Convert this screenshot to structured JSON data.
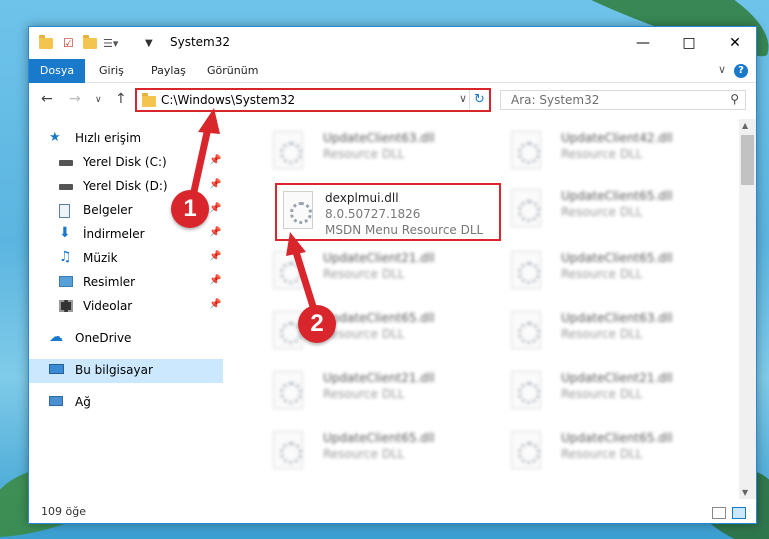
{
  "window": {
    "title": "System32",
    "accent": "#1979ca",
    "highlight": "#d9262c"
  },
  "ribbon": {
    "tabs": [
      "Dosya",
      "Giriş",
      "Paylaş",
      "Görünüm"
    ],
    "help_label": "?"
  },
  "nav": {
    "address": "C:\\Windows\\System32",
    "search_placeholder": "Ara: System32"
  },
  "sidebar": {
    "items": [
      {
        "label": "Hızlı erişim",
        "icon": "star-icon"
      },
      {
        "label": "Yerel Disk (C:)",
        "icon": "drive-icon"
      },
      {
        "label": "Yerel Disk (D:)",
        "icon": "drive-icon"
      },
      {
        "label": "Belgeler",
        "icon": "documents-icon"
      },
      {
        "label": "İndirmeler",
        "icon": "download-icon"
      },
      {
        "label": "Müzik",
        "icon": "music-icon"
      },
      {
        "label": "Resimler",
        "icon": "pictures-icon"
      },
      {
        "label": "Videolar",
        "icon": "videos-icon"
      },
      {
        "label": "OneDrive",
        "icon": "cloud-icon"
      },
      {
        "label": "Bu bilgisayar",
        "icon": "computer-icon"
      },
      {
        "label": "Ağ",
        "icon": "network-icon"
      }
    ]
  },
  "files": [
    {
      "name": "UpdateClient63.dll",
      "desc": "Resource DLL"
    },
    {
      "name": "UpdateClient42.dll",
      "desc": "Resource DLL"
    },
    {
      "name": "UpdateClient65.dll",
      "desc": "Resource DLL"
    },
    {
      "name": "UpdateClient21.dll",
      "desc": "Resource DLL"
    },
    {
      "name": "UpdateClient65.dll",
      "desc": "Resource DLL"
    },
    {
      "name": "UpdateClient65.dll",
      "desc": "Resource DLL"
    },
    {
      "name": "UpdateClient63.dll",
      "desc": "Resource DLL"
    },
    {
      "name": "UpdateClient21.dll",
      "desc": "Resource DLL"
    },
    {
      "name": "UpdateClient21.dll",
      "desc": "Resource DLL"
    },
    {
      "name": "UpdateClient65.dll",
      "desc": "Resource DLL"
    },
    {
      "name": "UpdateClient65.dll",
      "desc": "Resource DLL"
    }
  ],
  "highlighted_file": {
    "name": "dexplmui.dll",
    "version": "8.0.50727.1826",
    "desc": "MSDN Menu Resource DLL"
  },
  "status": {
    "count": "109 öğe"
  },
  "annotations": [
    "1",
    "2"
  ]
}
